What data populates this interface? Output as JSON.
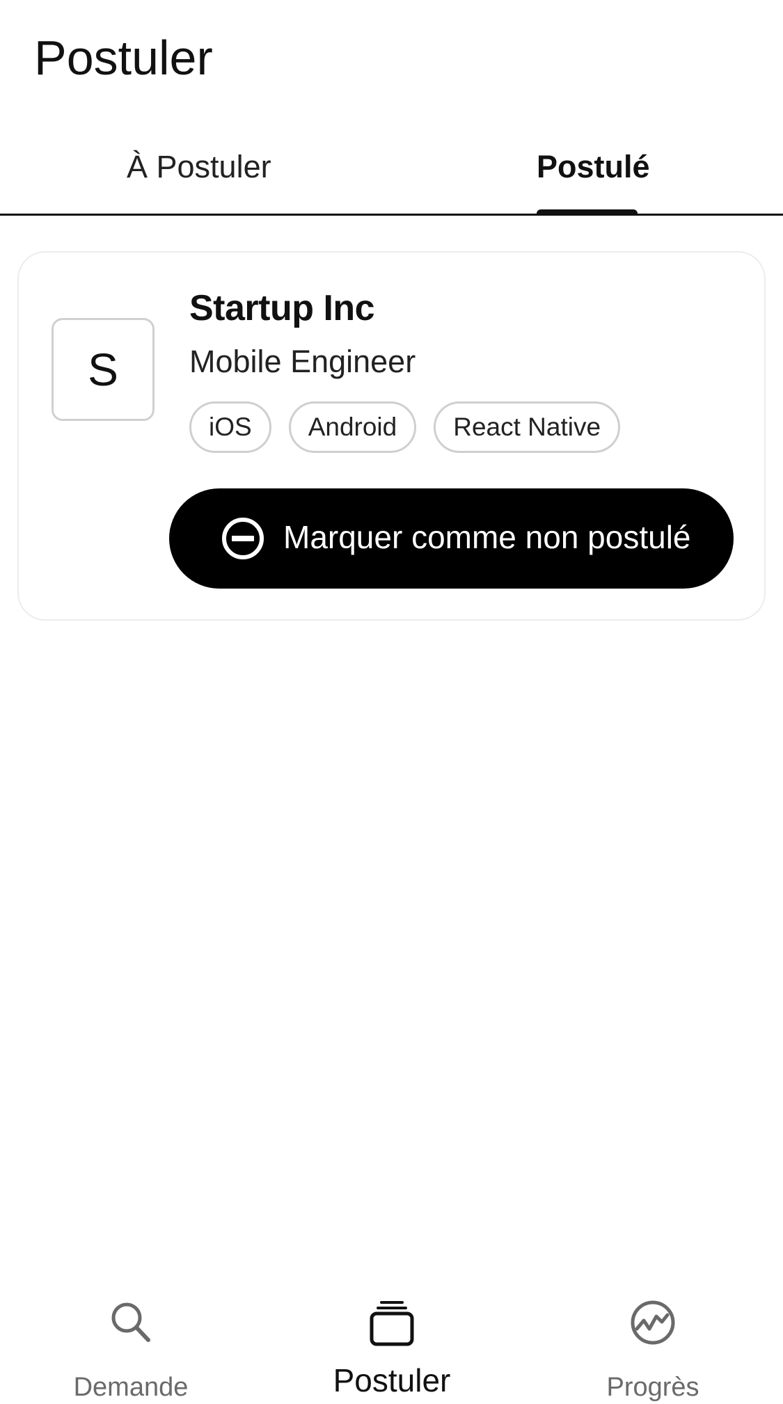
{
  "header": {
    "title": "Postuler"
  },
  "tabs": [
    {
      "label": "À Postuler",
      "active": false
    },
    {
      "label": "Postulé",
      "active": true
    }
  ],
  "card": {
    "logo_letter": "S",
    "company": "Startup Inc",
    "role": "Mobile Engineer",
    "tags": [
      "iOS",
      "Android",
      "React Native"
    ],
    "action_label": "Marquer comme non postulé",
    "action_icon": "minus-circle-icon"
  },
  "bottom_nav": [
    {
      "label": "Demande",
      "icon": "search-icon",
      "active": false
    },
    {
      "label": "Postuler",
      "icon": "stack-icon",
      "active": true
    },
    {
      "label": "Progrès",
      "icon": "progress-icon",
      "active": false
    }
  ],
  "colors": {
    "primary": "#000000",
    "background": "#ffffff",
    "inactive": "#6a6a6a",
    "border": "#cfcfcf"
  }
}
